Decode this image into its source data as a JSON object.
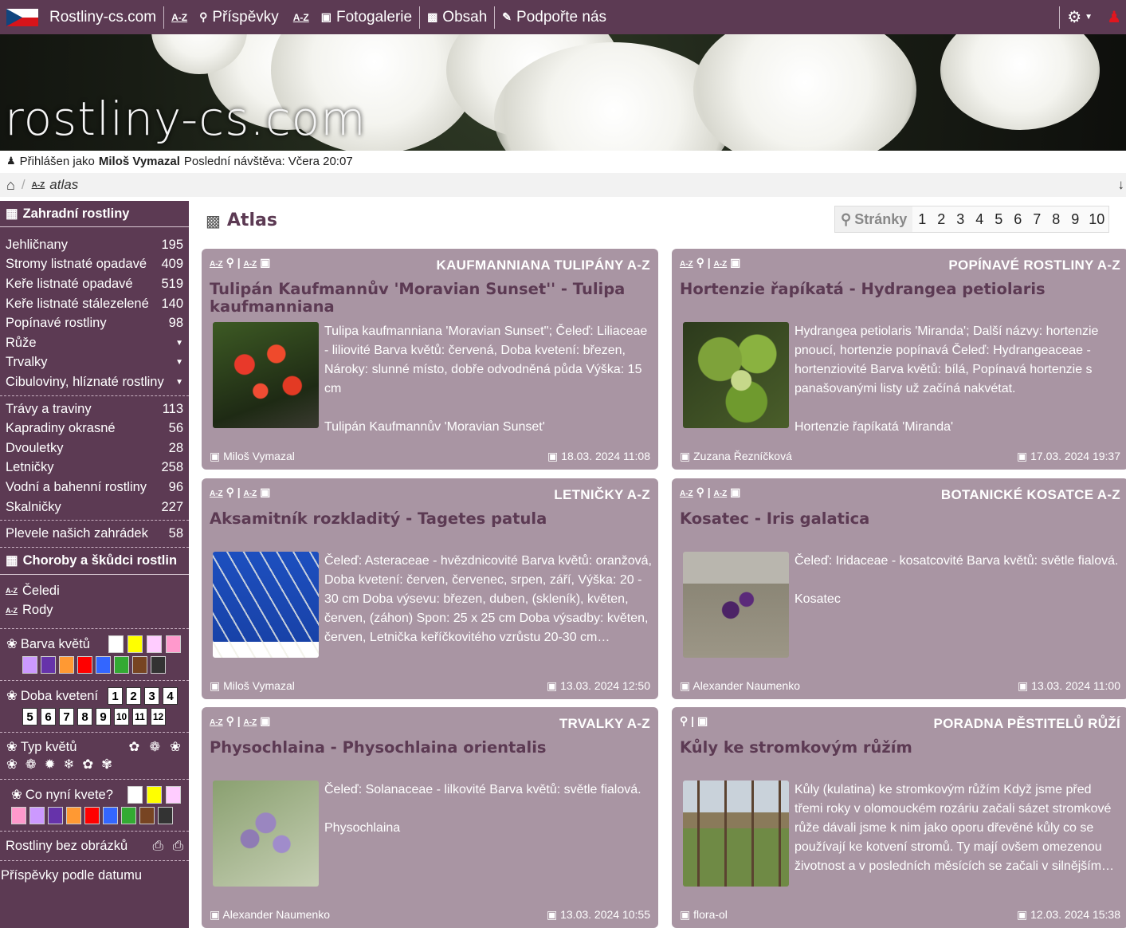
{
  "topnav": {
    "site": "Rostliny-cs.com",
    "items": [
      {
        "icon": "A-Z",
        "label": ""
      },
      {
        "icon": "🔍",
        "label": "Příspěvky"
      },
      {
        "icon": "A-Z",
        "label": ""
      },
      {
        "icon": "📷",
        "label": "Fotogalerie"
      },
      {
        "icon": "F",
        "label": "Obsah"
      },
      {
        "icon": "✎",
        "label": "Podpořte nás"
      }
    ]
  },
  "banner": {
    "title": "rostliny-cs.com"
  },
  "login": {
    "prefix": "Přihlášen jako",
    "user": "Miloš Vymazal",
    "last_visit": "Poslední návštěva: Včera 20:07"
  },
  "breadcrumb": {
    "current": "atlas"
  },
  "sidebar": {
    "section1": "Zahradní rostliny",
    "group1": [
      {
        "label": "Jehličnany",
        "count": "195"
      },
      {
        "label": "Stromy listnaté opadavé",
        "count": "409"
      },
      {
        "label": "Keře listnaté opadavé",
        "count": "519"
      },
      {
        "label": "Keře listnaté stálezelené",
        "count": "140"
      },
      {
        "label": "Popínavé rostliny",
        "count": "98"
      },
      {
        "label": "Růže",
        "count": ""
      },
      {
        "label": "Trvalky",
        "count": ""
      },
      {
        "label": "Cibuloviny, hlíznaté rostliny",
        "count": ""
      }
    ],
    "group2": [
      {
        "label": "Trávy a traviny",
        "count": "113"
      },
      {
        "label": "Kapradiny okrasné",
        "count": "56"
      },
      {
        "label": "Dvouletky",
        "count": "28"
      },
      {
        "label": "Letničky",
        "count": "258"
      },
      {
        "label": "Vodní a bahenní rostliny",
        "count": "96"
      },
      {
        "label": "Skalničky",
        "count": "227"
      }
    ],
    "weeds": {
      "label": "Plevele našich zahrádek",
      "count": "58"
    },
    "section2": "Choroby a škůdci rostlin",
    "celedi": "Čeledi",
    "rody": "Rody",
    "barva": "Barva květů",
    "doba": "Doba kvetení",
    "typ": "Typ květů",
    "nyni": "Co nyní kvete?",
    "bez": "Rostliny bez obrázků",
    "podle": "Příspěvky podle datumu",
    "colors_row1": [
      "#ffffff",
      "#ffff00",
      "#ffccff",
      "#ff99cc"
    ],
    "colors_row2": [
      "#cc99ff",
      "#6633aa",
      "#ff9933",
      "#ff0000",
      "#3366ff",
      "#33aa33",
      "#774422",
      "#333333"
    ],
    "months": [
      "1",
      "2",
      "3",
      "4",
      "5",
      "6",
      "7",
      "8",
      "9",
      "10",
      "11",
      "12"
    ],
    "nyni_row1": [
      "#ffffff",
      "#ffff00",
      "#ffccff"
    ],
    "nyni_row2": [
      "#ff99cc",
      "#cc99ff",
      "#6633aa",
      "#ff9933",
      "#ff0000",
      "#3366ff",
      "#33aa33",
      "#774422",
      "#333333"
    ]
  },
  "main": {
    "title": "Atlas",
    "pager_label": "Stránky",
    "pages": [
      "1",
      "2",
      "3",
      "4",
      "5",
      "6",
      "7",
      "8",
      "9",
      "10"
    ]
  },
  "cards": [
    {
      "category": "KAUFMANNIANA TULIPÁNY A-Z",
      "title": "Tulipán Kaufmannův 'Moravian Sunset'' - Tulipa kaufmanniana",
      "text": "Tulipa kaufmanniana 'Moravian Sunset''; Čeleď: Liliaceae - liliovité Barva květů: červená, Doba kvetení: březen, Nároky: slunné místo, dobře odvodněná půda Výška: 15 cm",
      "caption": "Tulipán Kaufmannův 'Moravian Sunset'",
      "author": "Miloš Vymazal",
      "date": "18.03. 2024 11:08"
    },
    {
      "category": "POPÍNAVÉ ROSTLINY A-Z",
      "title": "Hortenzie řapíkatá - Hydrangea petiolaris",
      "text": "Hydrangea petiolaris 'Miranda'; Další názvy: hortenzie pnoucí, hortenzie popínavá Čeleď: Hydrangeaceae - hortenziovité Barva květů: bílá, Popínavá hortenzie s panašovanými listy už začíná nakvétat.",
      "caption": "Hortenzie řapíkatá 'Miranda'",
      "author": "Zuzana Řezníčková",
      "date": "17.03. 2024 19:37"
    },
    {
      "category": "LETNIČKY A-Z",
      "title": "Aksamitník rozkladitý - Tagetes patula",
      "text": "Čeleď: Asteraceae - hvězdnicovité Barva květů: oranžová, Doba kvetení: červen, červenec, srpen, září, Výška: 20 - 30 cm Doba výsevu: březen, duben, (skleník), květen, červen, (záhon) Spon: 25 x 25 cm Doba výsadby: květen, červen, Letnička keříčkovitého vzrůstu 20-30 cm…",
      "caption": "",
      "author": "Miloš Vymazal",
      "date": "13.03. 2024 12:50"
    },
    {
      "category": "BOTANICKÉ KOSATCE A-Z",
      "title": "Kosatec - Iris galatica",
      "text": "Čeleď: Iridaceae - kosatcovité Barva květů: světle fialová.",
      "caption": "Kosatec",
      "author": "Alexander Naumenko",
      "date": "13.03. 2024 11:00"
    },
    {
      "category": "TRVALKY A-Z",
      "title": "Physochlaina - Physochlaina orientalis",
      "text": "Čeleď: Solanaceae - lilkovité Barva květů: světle fialová.",
      "caption": "Physochlaina",
      "author": "Alexander Naumenko",
      "date": "13.03. 2024 10:55"
    },
    {
      "category": "PORADNA PĚSTITELŮ RŮŽÍ",
      "title": "Kůly ke stromkovým růžím",
      "text": "Kůly (kulatina) ke stromkovým růžím Když jsme před třemi roky v olomouckém rozáriu začali sázet stromkové růže dávali jsme k nim jako oporu dřevěné kůly co se používají ke kotvení stromů. Ty mají ovšem omezenou životnost a v posledních měsících se začali v silnějším…",
      "caption": "",
      "author": "flora-ol",
      "date": "12.03. 2024 15:38"
    }
  ]
}
